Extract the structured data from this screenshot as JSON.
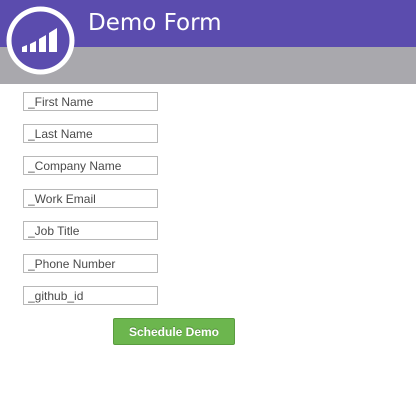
{
  "header": {
    "title": "Demo Form",
    "brand_color": "#5b4cae",
    "band_color": "#a9a8ad",
    "logo_icon": "bar-chart-logo-icon"
  },
  "form": {
    "fields": [
      {
        "name": "first-name",
        "placeholder": "_First Name",
        "value": ""
      },
      {
        "name": "last-name",
        "placeholder": "_Last Name",
        "value": ""
      },
      {
        "name": "company-name",
        "placeholder": "_Company Name",
        "value": ""
      },
      {
        "name": "work-email",
        "placeholder": "_Work Email",
        "value": ""
      },
      {
        "name": "job-title",
        "placeholder": "_Job Title",
        "value": ""
      },
      {
        "name": "phone-number",
        "placeholder": "_Phone Number",
        "value": ""
      },
      {
        "name": "github-id",
        "placeholder": "_github_id",
        "value": ""
      }
    ],
    "submit_label": "Schedule Demo",
    "submit_color": "#6cb64e"
  }
}
